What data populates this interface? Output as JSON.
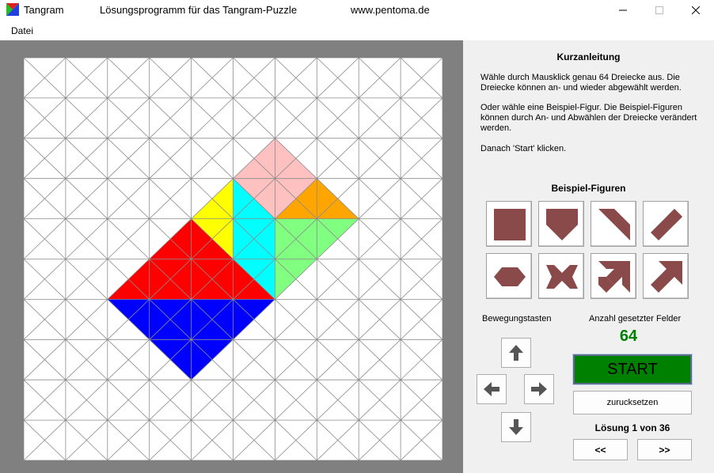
{
  "titlebar": {
    "app_name": "Tangram",
    "subtitle": "Lösungsprogramm für das Tangram-Puzzle",
    "website": "www.pentoma.de",
    "minimize": "—",
    "maximize": "☐",
    "close": "✕"
  },
  "menu": {
    "file": "Datei"
  },
  "instructions": {
    "title": "Kurzanleitung",
    "para1": "Wähle durch Mausklick genau 64 Dreiecke aus. Die Dreiecke können an- und wieder abgewählt werden.",
    "para2": "Oder wähle eine Beispiel-Figur. Die Beispiel-Figuren können durch An- und Abwählen der Dreiecke verändert werden.",
    "para3": "Danach 'Start' klicken."
  },
  "examples": {
    "title": "Beispiel-Figuren",
    "figure_color": "#8b4a4a",
    "items": [
      "square-figure-icon",
      "pentagon-figure-icon",
      "trapezoid-figure-icon",
      "parallelogram-figure-icon",
      "hexagon-figure-icon",
      "bowtie-figure-icon",
      "arrow-double-figure-icon",
      "arrow-figure-icon"
    ]
  },
  "movement": {
    "label": "Bewegungstasten",
    "up": "up-arrow-icon",
    "left": "left-arrow-icon",
    "right": "right-arrow-icon",
    "down": "down-arrow-icon"
  },
  "count": {
    "label": "Anzahl gesetzter Felder",
    "value": "64"
  },
  "actions": {
    "start": "START",
    "reset": "zurucksetzen",
    "prev": "<<",
    "next": ">>"
  },
  "solution": {
    "text": "Lösung 1 von 36"
  },
  "board": {
    "rows": 10,
    "cols": 10,
    "pieces": [
      {
        "name": "pink",
        "color": "#ffc0c0"
      },
      {
        "name": "orange",
        "color": "#ffa500"
      },
      {
        "name": "yellow",
        "color": "#ffff00"
      },
      {
        "name": "cyan",
        "color": "#00ffff"
      },
      {
        "name": "light-green",
        "color": "#80ff80"
      },
      {
        "name": "red",
        "color": "#ff0000"
      },
      {
        "name": "blue",
        "color": "#0000ff"
      }
    ]
  }
}
